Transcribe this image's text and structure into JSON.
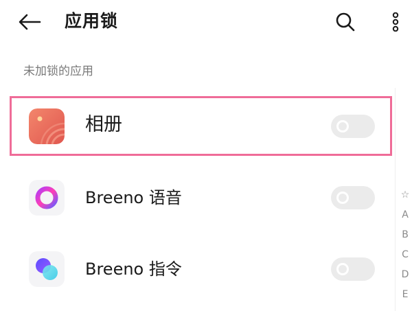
{
  "header": {
    "title": "应用锁",
    "back_icon": "back-arrow-icon",
    "search_icon": "search-icon",
    "more_icon": "more-vertical-icon"
  },
  "section": {
    "label": "未加锁的应用"
  },
  "apps": [
    {
      "name": "相册",
      "icon": "gallery-icon",
      "locked": false,
      "highlighted": true
    },
    {
      "name": "Breeno 语音",
      "icon": "breeno-voice-icon",
      "locked": false,
      "highlighted": false
    },
    {
      "name": "Breeno 指令",
      "icon": "breeno-command-icon",
      "locked": false,
      "highlighted": false
    }
  ],
  "index_bar": {
    "items": [
      "☆",
      "A",
      "B",
      "C",
      "D",
      "E"
    ]
  },
  "colors": {
    "highlight_border": "#ef6c98",
    "toggle_off": "#ebebeb",
    "section_text": "#7a7a7a"
  }
}
